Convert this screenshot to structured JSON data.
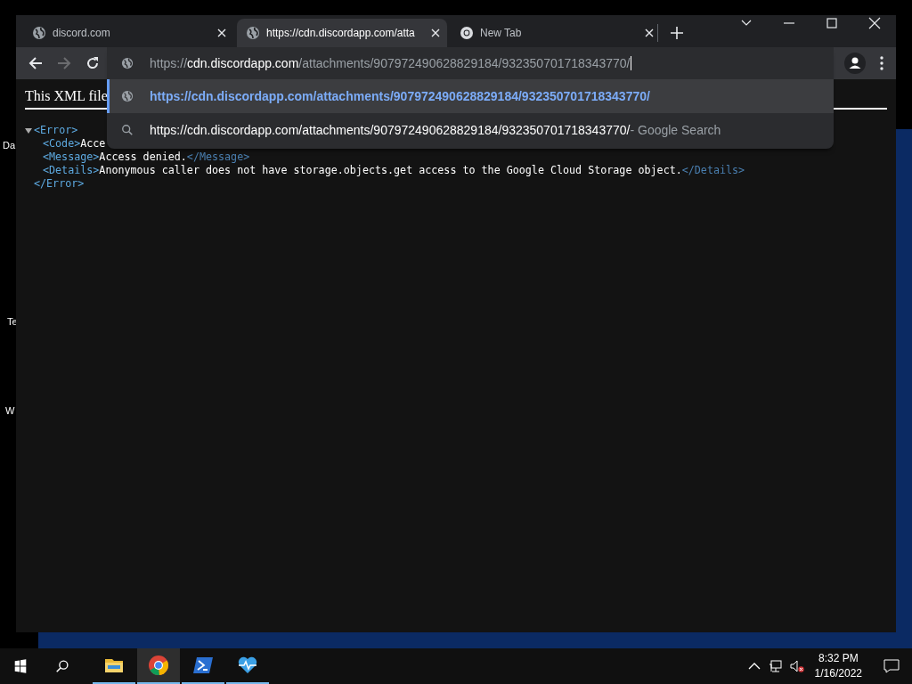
{
  "desktop": {
    "icon_labels": [
      "Da",
      "Te",
      "W"
    ]
  },
  "browser": {
    "tabs": [
      {
        "title": "discord.com",
        "selected": false,
        "kind": "globe"
      },
      {
        "title": "https://cdn.discordapp.com/atta",
        "selected": true,
        "kind": "globe"
      },
      {
        "title": "New Tab",
        "selected": false,
        "kind": "chrome"
      }
    ],
    "omnibox": {
      "scheme": "https://",
      "host": "cdn.discordapp.com",
      "path": "/attachments/907972490628829184/932350701718343770/"
    },
    "suggestions": [
      {
        "kind": "url",
        "text": "https://cdn.discordapp.com/attachments/907972490628829184/932350701718343770/",
        "selected": true
      },
      {
        "kind": "search",
        "text": "https://cdn.discordapp.com/attachments/907972490628829184/932350701718343770/",
        "suffix": "- Google Search",
        "selected": false
      }
    ],
    "content": {
      "banner": "This XML file",
      "xml": {
        "open": "<Error>",
        "close": "</Error>",
        "expanded": true,
        "children": [
          {
            "open": "<Code>",
            "text": "Acce"
          },
          {
            "open": "<Message>",
            "text": "Access denied.",
            "close": "</Message>"
          },
          {
            "open": "<Details>",
            "text": "Anonymous caller does not have storage.objects.get access to the Google Cloud Storage object.",
            "close": "</Details>"
          }
        ]
      }
    }
  },
  "taskbar": {
    "apps": [
      {
        "kind": "folder",
        "selected": false
      },
      {
        "kind": "chrome",
        "selected": true
      },
      {
        "kind": "powershell",
        "selected": false
      },
      {
        "kind": "heartbeat",
        "selected": false
      }
    ],
    "time": "8:32 PM",
    "date": "1/16/2022"
  }
}
